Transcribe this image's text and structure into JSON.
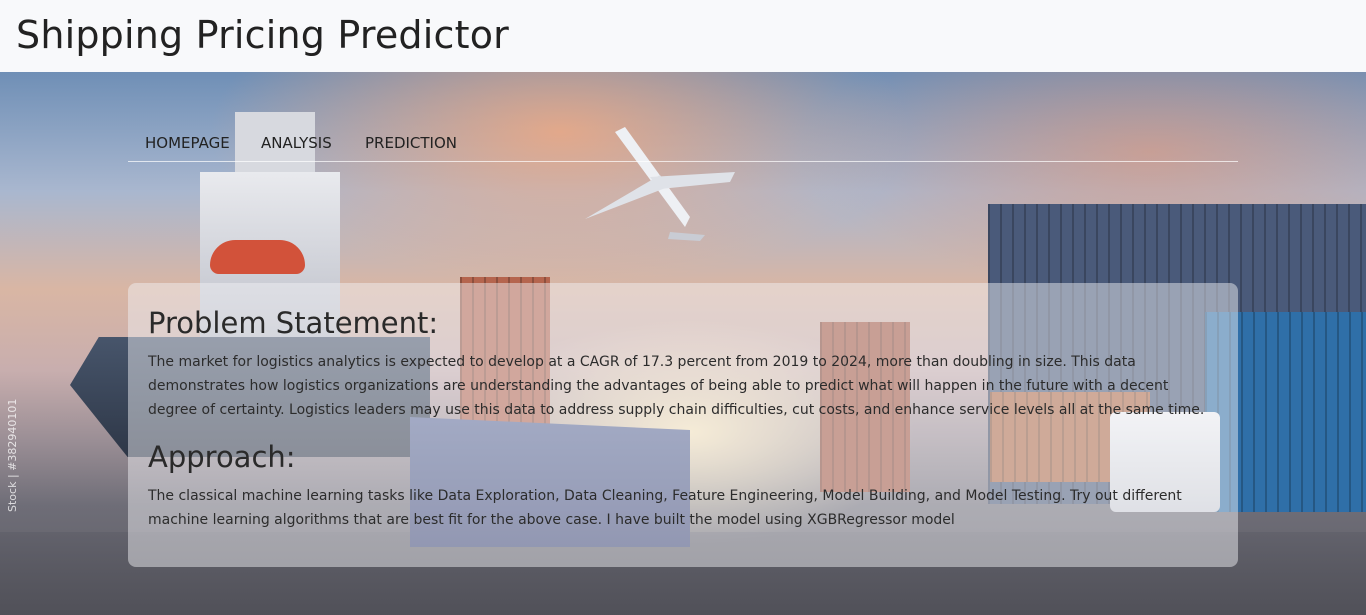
{
  "header": {
    "title": "Shipping Pricing Predictor"
  },
  "nav": {
    "items": [
      {
        "label": "HOMEPAGE"
      },
      {
        "label": "ANALYSIS"
      },
      {
        "label": "PREDICTION"
      }
    ]
  },
  "content": {
    "problem": {
      "heading": "Problem Statement:",
      "text": "The market for logistics analytics is expected to develop at a CAGR of 17.3 percent from 2019 to 2024, more than doubling in size. This data demonstrates how logistics organizations are understanding the advantages of being able to predict what will happen in the future with a decent degree of certainty. Logistics leaders may use this data to address supply chain difficulties, cut costs, and enhance service levels all at the same time."
    },
    "approach": {
      "heading": "Approach:",
      "text": "The classical machine learning tasks like Data Exploration, Data Cleaning, Feature Engineering, Model Building, and Model Testing. Try out different machine learning algorithms that are best fit for the above case. I have built the model using XGBRegressor model"
    }
  },
  "background": {
    "watermark": "Stock | #382940101"
  },
  "colors": {
    "header_bg": "#f8f9fb",
    "text": "#222222"
  }
}
